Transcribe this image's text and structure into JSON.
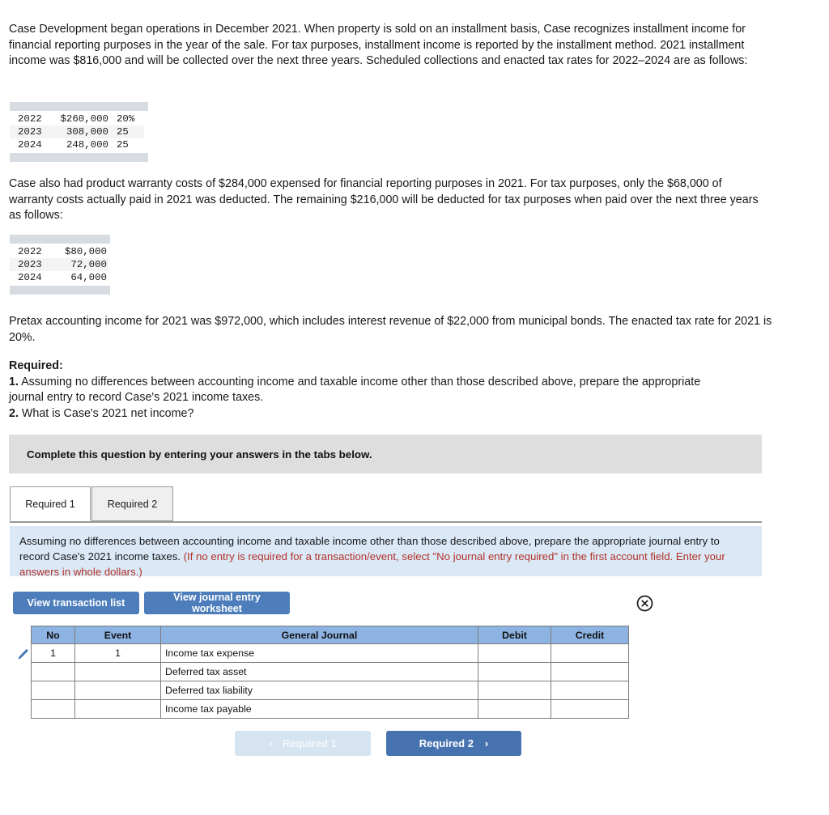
{
  "problem": {
    "paragraph1": "Case Development began operations in December 2021. When property is sold on an installment basis, Case recognizes installment income for financial reporting purposes in the year of the sale. For tax purposes, installment income is reported by the installment method. 2021 installment income was $816,000 and will be collected over the next three years. Scheduled collections and enacted tax rates for 2022–2024 are as follows:",
    "paragraph2": "Case also had product warranty costs of $284,000 expensed for financial reporting purposes in 2021. For tax purposes, only the $68,000 of warranty costs actually paid in 2021 was deducted. The remaining $216,000 will be deducted for tax purposes when paid over the next three years as follows:",
    "paragraph3": "Pretax accounting income for 2021 was $972,000, which includes interest revenue of $22,000 from municipal bonds. The enacted tax rate for 2021 is 20%."
  },
  "collections_table": {
    "rows": [
      {
        "year": "2022",
        "amount": "$260,000",
        "rate": "20%"
      },
      {
        "year": "2023",
        "amount": "308,000",
        "rate": "25"
      },
      {
        "year": "2024",
        "amount": "248,000",
        "rate": "25"
      }
    ]
  },
  "warranty_table": {
    "rows": [
      {
        "year": "2022",
        "amount": "$80,000"
      },
      {
        "year": "2023",
        "amount": "72,000"
      },
      {
        "year": "2024",
        "amount": "64,000"
      }
    ]
  },
  "required": {
    "label": "Required:",
    "item1_number": "1.",
    "item1_text": " Assuming no differences between accounting income and taxable income other than those described above, prepare the appropriate journal entry to record Case's 2021 income taxes.",
    "item2_number": "2.",
    "item2_text": " What is Case's 2021 net income?"
  },
  "banner": {
    "text": "Complete this question by entering your answers in the tabs below."
  },
  "tabs": [
    {
      "label": "Required 1",
      "active": true
    },
    {
      "label": "Required 2",
      "active": false
    }
  ],
  "instruction": {
    "black_text": "Assuming no differences between accounting income and taxable income other than those described above, prepare the appropriate journal entry to record Case's 2021 income taxes. ",
    "red_text": "(If no entry is required for a transaction/event, select \"No journal entry required\" in the first account field. Enter your answers in whole dollars.)"
  },
  "toolbar": {
    "view_transaction_list": "View transaction list",
    "view_journal_entry_worksheet": "View journal entry worksheet",
    "close_icon": "circle-x-icon"
  },
  "journal": {
    "columns": [
      "No",
      "Event",
      "General Journal",
      "Debit",
      "Credit"
    ],
    "rows": [
      {
        "no": "1",
        "event": "1",
        "account": "Income tax expense",
        "debit": "",
        "credit": ""
      },
      {
        "no": "",
        "event": "",
        "account": "Deferred tax asset",
        "debit": "",
        "credit": ""
      },
      {
        "no": "",
        "event": "",
        "account": "Deferred tax liability",
        "debit": "",
        "credit": ""
      },
      {
        "no": "",
        "event": "",
        "account": "Income tax payable",
        "debit": "",
        "credit": ""
      }
    ],
    "edit_icon": "pencil-icon"
  },
  "nav": {
    "prev_label": "Required 1",
    "prev_chevron": "‹",
    "prev_disabled": true,
    "next_label": "Required 2",
    "next_chevron": "›"
  },
  "colors": {
    "accent_blue": "#4d7ebb",
    "table_header_blue": "#8db3e2",
    "instruction_blue": "#dbe9f6",
    "banner_gray": "#dedede",
    "warning_red": "#b33229"
  }
}
